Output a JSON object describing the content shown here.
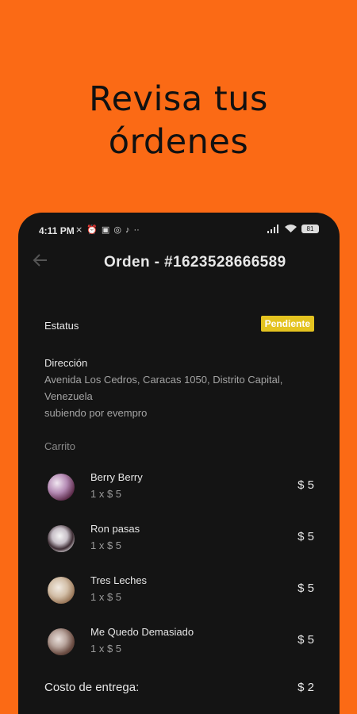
{
  "promo": {
    "line1": "Revisa tus",
    "line2": "órdenes"
  },
  "statusbar": {
    "time": "4:11 PM",
    "battery": "81"
  },
  "appbar": {
    "title": "Orden - #1623528666589"
  },
  "order": {
    "status_label": "Estatus",
    "status_value": "Pendiente",
    "status_color": "#e4c320",
    "address_label": "Dirección",
    "address_line1": "Avenida Los Cedros, Caracas 1050, Distrito Capital,",
    "address_line2": "Venezuela",
    "address_note": "subiendo por evempro"
  },
  "cart": {
    "label": "Carrito",
    "items": [
      {
        "name": "Berry Berry",
        "qty": "1 x $ 5",
        "price": "$ 5"
      },
      {
        "name": "Ron pasas",
        "qty": "1 x $ 5",
        "price": "$ 5"
      },
      {
        "name": "Tres Leches",
        "qty": "1 x $ 5",
        "price": "$ 5"
      },
      {
        "name": "Me Quedo Demasiado",
        "qty": "1 x $ 5",
        "price": "$ 5"
      }
    ]
  },
  "delivery": {
    "label": "Costo de entrega:",
    "price": "$ 2"
  },
  "colors": {
    "accent": "#fb6a15",
    "background": "#141414"
  }
}
